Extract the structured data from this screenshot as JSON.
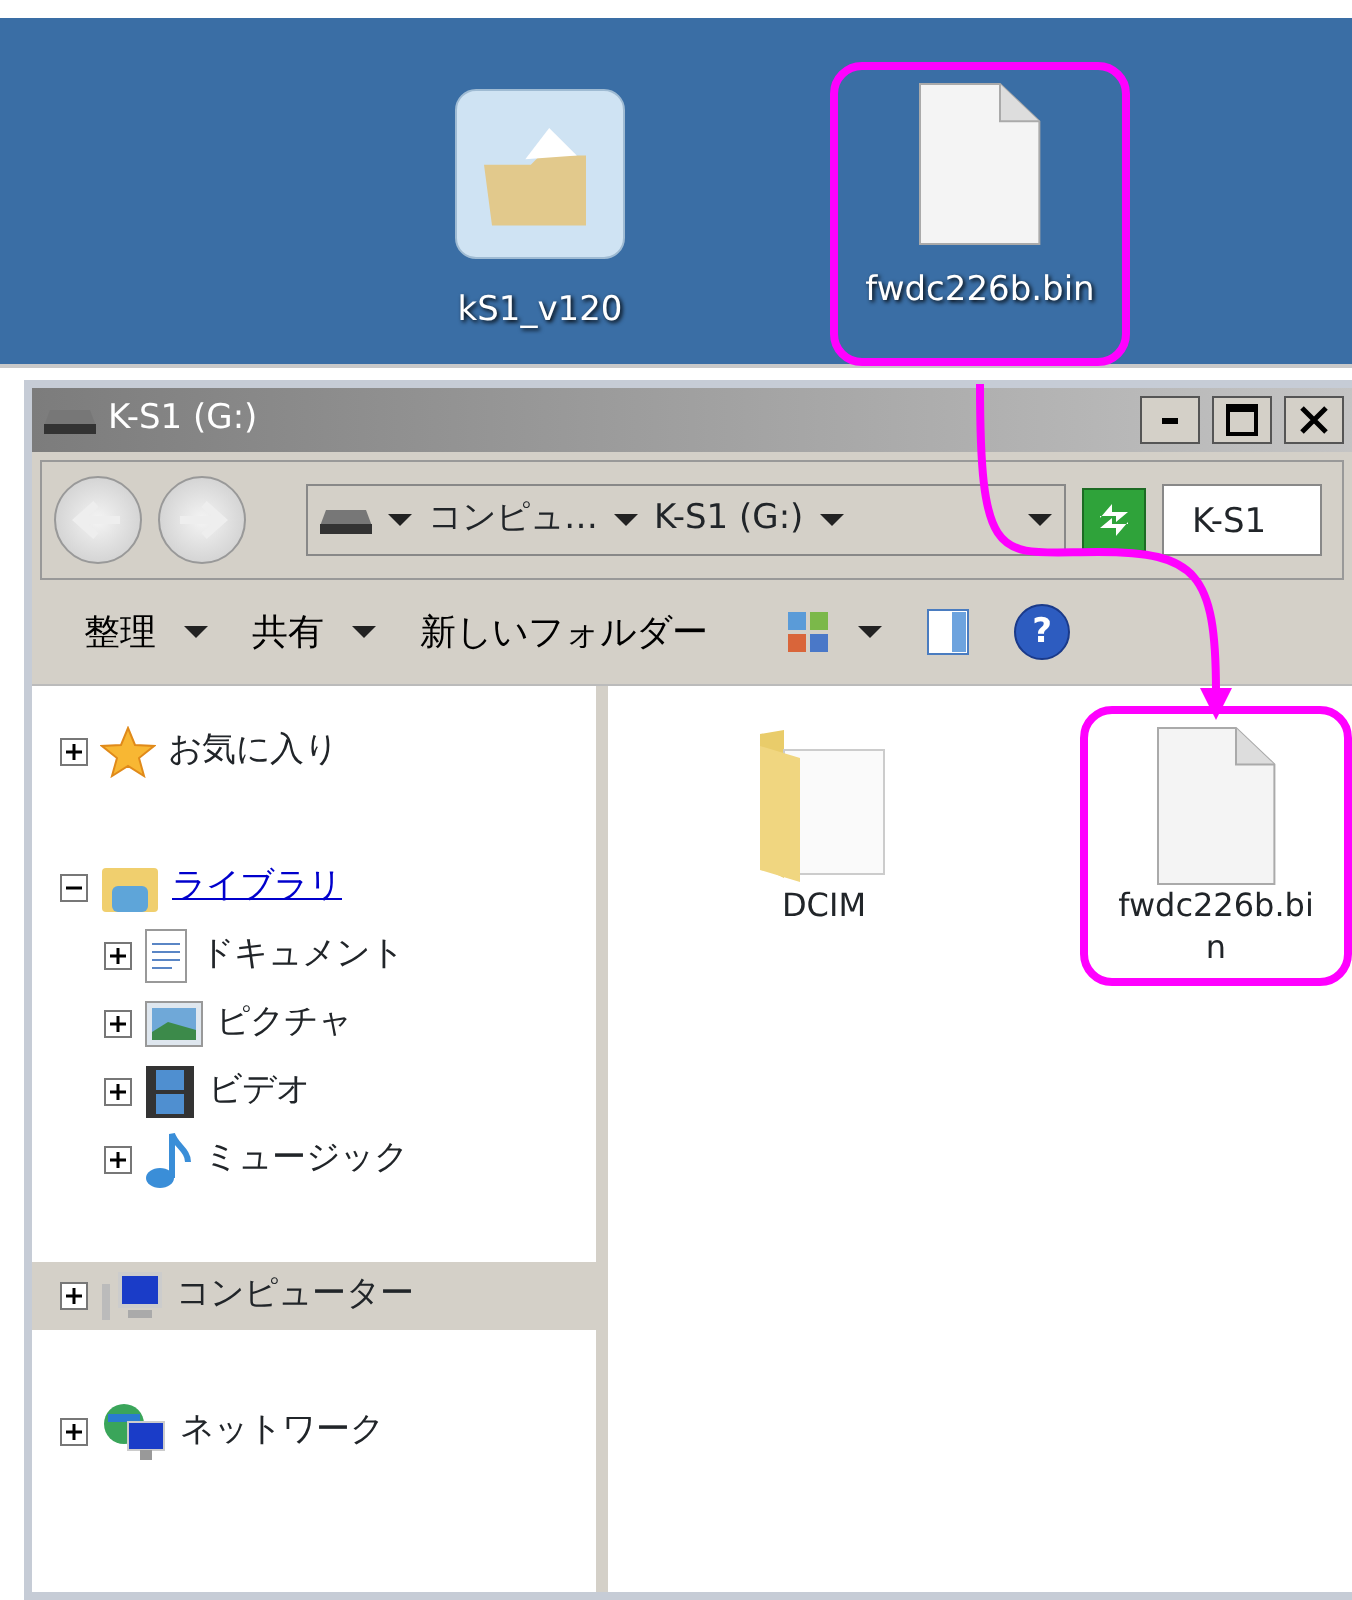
{
  "desktop": {
    "icons": [
      {
        "label": "kS1_v120",
        "kind": "package",
        "highlighted": false
      },
      {
        "label": "fwdc226b.bin",
        "kind": "file",
        "highlighted": true
      }
    ]
  },
  "window": {
    "title": "K-S1 (G:)",
    "breadcrumb": [
      "コンピュ…",
      "K-S1 (G:)"
    ],
    "search": {
      "value": "K-S1"
    },
    "help_label": "?",
    "toolbar": [
      {
        "label": "整理",
        "dropdown": true
      },
      {
        "label": "共有",
        "dropdown": true
      },
      {
        "label": "新しいフォルダー",
        "dropdown": false
      }
    ],
    "nav_tree": [
      {
        "label": "お気に入り",
        "kind": "favorites",
        "expanded": false,
        "selected": false,
        "hover": false
      },
      {
        "label": "ライブラリ",
        "kind": "library",
        "expanded": true,
        "selected": false,
        "hover": true,
        "children": [
          {
            "label": "ドキュメント",
            "kind": "documents",
            "expanded": false,
            "selected": false,
            "hover": false
          },
          {
            "label": "ピクチャ",
            "kind": "pictures",
            "expanded": false,
            "selected": false,
            "hover": false
          },
          {
            "label": "ビデオ",
            "kind": "videos",
            "expanded": false,
            "selected": false,
            "hover": false
          },
          {
            "label": "ミュージック",
            "kind": "music",
            "expanded": false,
            "selected": false,
            "hover": false
          }
        ]
      },
      {
        "label": "コンピューター",
        "kind": "computer",
        "expanded": false,
        "selected": true,
        "hover": false
      },
      {
        "label": "ネットワーク",
        "kind": "network",
        "expanded": false,
        "selected": false,
        "hover": false
      }
    ],
    "files": [
      {
        "label": "DCIM",
        "kind": "folder",
        "highlighted": false
      },
      {
        "label": "fwdc226b.bin",
        "kind": "file",
        "highlighted": true
      }
    ]
  }
}
